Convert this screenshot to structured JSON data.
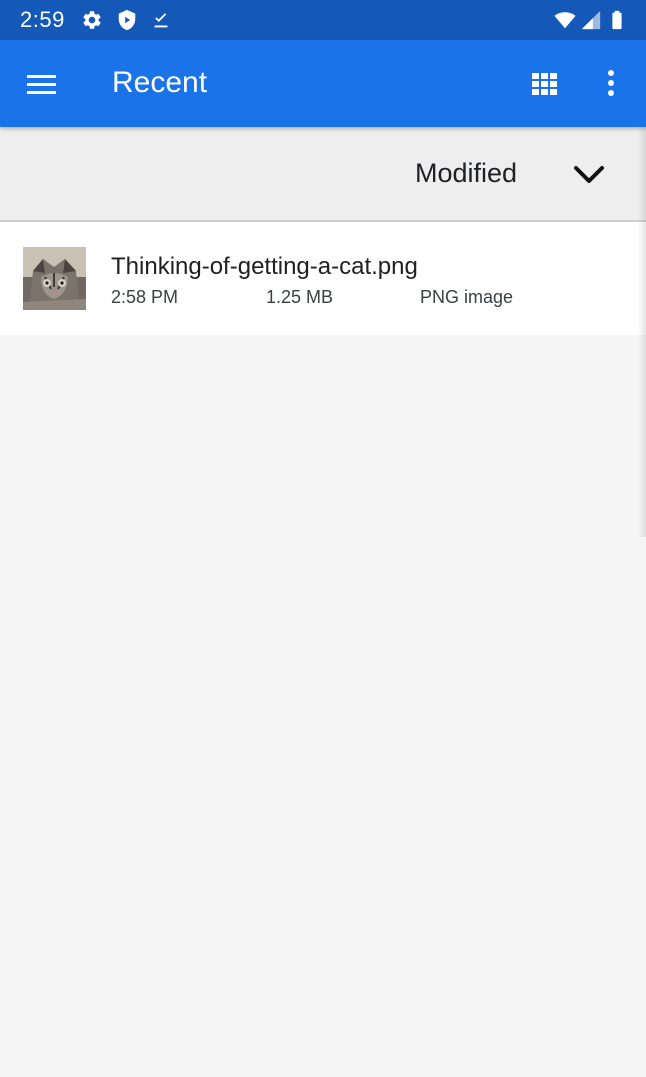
{
  "status_bar": {
    "time": "2:59",
    "left_icons": [
      "gear-icon",
      "shield-icon",
      "download-done-icon"
    ],
    "right_icons": [
      "wifi-icon",
      "cell-signal-icon",
      "battery-icon"
    ]
  },
  "app_bar": {
    "title": "Recent",
    "menu_icon": "hamburger-menu-icon",
    "view_toggle_icon": "grid-view-icon",
    "overflow_icon": "more-vert-icon"
  },
  "sort": {
    "label": "Modified",
    "icon": "chevron-down-icon"
  },
  "files": [
    {
      "name": "Thinking-of-getting-a-cat.png",
      "time": "2:58 PM",
      "size": "1.25 MB",
      "type": "PNG image"
    }
  ],
  "colors": {
    "status_bar": "#1559b8",
    "app_bar": "#1a73e8",
    "sort_bar": "#eeeeee",
    "background": "#f5f5f5"
  }
}
